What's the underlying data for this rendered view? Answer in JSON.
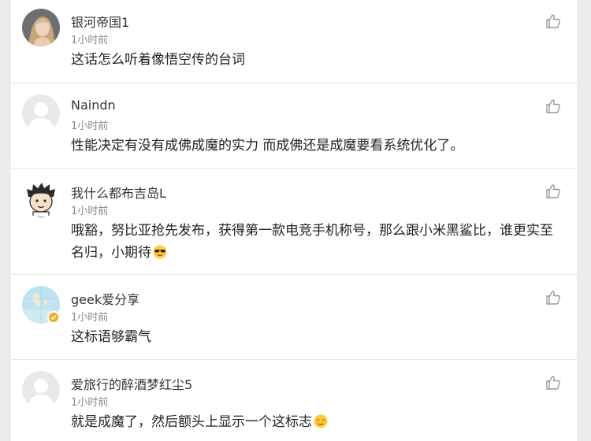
{
  "comments": [
    {
      "username": "银河帝国1",
      "time": "1小时前",
      "text": "这话怎么听着像悟空传的台词",
      "avatar": "woman-photo-avatar",
      "verified": false
    },
    {
      "username": "Naindn",
      "time": "1小时前",
      "text": "性能决定有没有成佛成魔的实力 而成佛还是成魔要看系统优化了。",
      "avatar": "default-avatar",
      "verified": false
    },
    {
      "username": "我什么都布吉岛L",
      "time": "1小时前",
      "text": "哦豁，努比亚抢先发布，获得第一款电竞手机称号，那么跟小米黑鲨比，谁更实至名归，小期待",
      "emoji": "sunglasses-emoji",
      "avatar": "cartoon-boy-avatar",
      "verified": false
    },
    {
      "username": "geek爱分享",
      "time": "1小时前",
      "text": "这标语够霸气",
      "avatar": "map-avatar",
      "verified": true
    },
    {
      "username": "爱旅行的醉酒梦红尘5",
      "time": "1小时前",
      "text": "就是成魔了，然后额头上显示一个这标志",
      "emoji": "relieved-emoji",
      "avatar": "default-avatar",
      "verified": false
    }
  ],
  "colors": {
    "username": "#333333",
    "time": "#8a8a8a",
    "text": "#222222",
    "divider": "#e6e6e6",
    "verified_badge": "#f5a623"
  },
  "icons": {
    "like": "thumbs-up-icon"
  }
}
